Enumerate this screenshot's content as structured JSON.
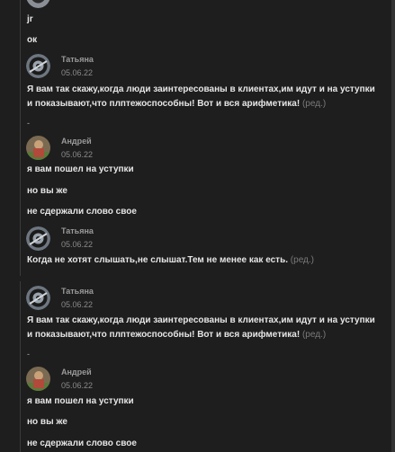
{
  "messages": {
    "top_line_1": "jr",
    "top_line_2": "ок",
    "m1": {
      "author": "Татьяна",
      "date": "05.06.22",
      "text": "Я вам так скажу,когда люди заинтересованы в клиентах,им идут и на уступки и показывают,что плптежоспособны! Вот и вся арифметика!",
      "edited": "(ред.)"
    },
    "dash_1": "-",
    "m2": {
      "author": "Андрей",
      "date": "05.06.22",
      "lines": [
        "я вам пошел на уступки",
        "но вы же",
        "не сдержали слово свое"
      ]
    },
    "m3": {
      "author": "Татьяна",
      "date": "05.06.22",
      "text": "Когда не хотят слышать,не слышат.Тем не менее как есть.",
      "edited": "(ред.)"
    },
    "m4": {
      "author": "Татьяна",
      "date": "05.06.22",
      "text": "Я вам так скажу,когда люди заинтересованы в клиентах,им идут и на уступки и показывают,что плптежоспособны! Вот и вся арифметика!",
      "edited": "(ред.)"
    },
    "dash_2": "-",
    "m5": {
      "author": "Андрей",
      "date": "05.06.22",
      "lines": [
        "я вам пошел на уступки",
        "но вы же",
        "не сдержали слово свое"
      ]
    }
  },
  "colors": {
    "background": "#1e1e1e",
    "text": "#e6e6e6",
    "meta": "#8a8a8a"
  },
  "icons": {
    "tatyana_avatar": "car-wheel-avatar",
    "andrey_avatar": "person-photo-avatar"
  }
}
